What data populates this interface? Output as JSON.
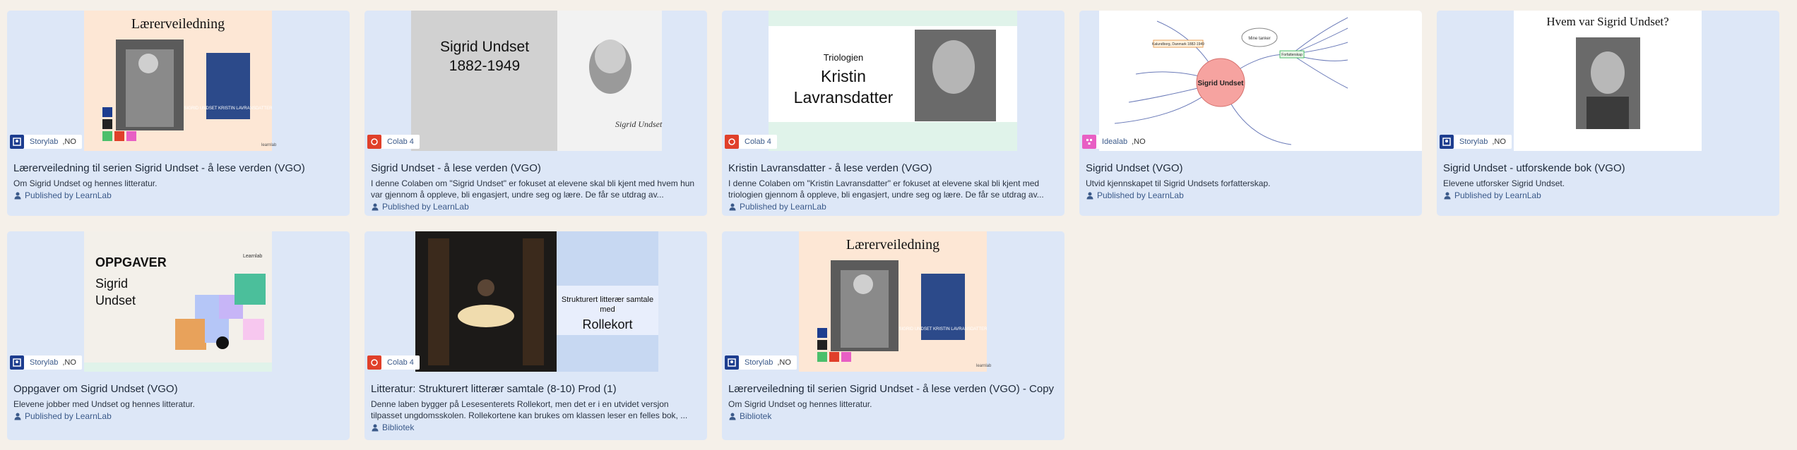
{
  "cards": [
    {
      "title": "Lærerveiledning til serien Sigrid Undset - å lese verden (VGO)",
      "desc": "Om Sigrid Undset og hennes litteratur.",
      "publisher": "Published by LearnLab",
      "lab": "Storylab",
      "lang": ",NO",
      "thumb_heading": "Lærerveiledning",
      "thumb_book": "SIGRID UNDSET KRISTIN LAVRANSDATTER",
      "thumb_logo": "learnlab"
    },
    {
      "title": "Sigrid Undset - å lese verden (VGO)",
      "desc": "I denne Colaben om \"Sigrid Undset\" er fokuset at elevene skal bli kjent med hvem hun var gjennom å oppleve, bli engasjert, undre seg og lære. De får se utdrag av...",
      "publisher": "Published by LearnLab",
      "lab": "Colab 4",
      "lang": "",
      "thumb_name": "Sigrid Undset",
      "thumb_years": "1882-1949",
      "thumb_signature": "Sigrid Undset"
    },
    {
      "title": "Kristin Lavransdatter - å lese verden (VGO)",
      "desc": "I denne Colaben om \"Kristin Lavransdatter\" er fokuset at elevene skal bli kjent med triologien gjennom å oppleve, bli engasjert, undre seg og lære. De får se utdrag av...",
      "publisher": "Published by LearnLab",
      "lab": "Colab 4",
      "lang": "",
      "thumb_small": "Triologien",
      "thumb_big1": "Kristin",
      "thumb_big2": "Lavransdatter"
    },
    {
      "title": "Sigrid Undset (VGO)",
      "desc": "Utvid kjennskapet til Sigrid Undsets forfatterskap.",
      "publisher": "Published by LearnLab",
      "lab": "Idealab",
      "lang": ",NO",
      "thumb_center": "Sigrid Undset",
      "thumb_note": "Mine tanker",
      "thumb_node1": "Forfatterskap",
      "thumb_node2": "Kalundborg, Danmark 1882-1949"
    },
    {
      "title": "Sigrid Undset - utforskende bok (VGO)",
      "desc": "Elevene utforsker Sigrid Undset.",
      "publisher": "Published by LearnLab",
      "lab": "Storylab",
      "lang": ",NO",
      "thumb_heading": "Hvem var Sigrid Undset?"
    },
    {
      "title": "Oppgaver om Sigrid Undset (VGO)",
      "desc": "Elevene jobber med Undset og hennes litteratur.",
      "publisher": "Published by LearnLab",
      "lab": "Storylab",
      "lang": ",NO",
      "thumb_heading": "OPPGAVER",
      "thumb_sub1": "Sigrid",
      "thumb_sub2": "Undset",
      "thumb_logo": "Learnlab"
    },
    {
      "title": "Litteratur: Strukturert litterær samtale (8-10) Prod (1)",
      "desc": "Denne laben bygger på Lesesenterets Rollekort, men det er i en utvidet versjon tilpasset ungdomsskolen. Rollekortene kan brukes om klassen leser en felles bok, ...",
      "publisher": "Bibliotek",
      "lab": "Colab 4",
      "lang": "",
      "thumb_small1": "Strukturert litterær samtale",
      "thumb_small2": "med",
      "thumb_big": "Rollekort"
    },
    {
      "title": "Lærerveiledning til serien Sigrid Undset - å lese verden (VGO) - Copy",
      "desc": "Om Sigrid Undset og hennes litteratur.",
      "publisher": "Bibliotek",
      "lab": "Storylab",
      "lang": ",NO",
      "thumb_heading": "Lærerveiledning",
      "thumb_book": "SIGRID UNDSET KRISTIN LAVRANSDATTER",
      "thumb_logo": "learnlab"
    }
  ],
  "colors": {
    "page_bg": "#f5f0e9",
    "card_bg": "#dde7f7",
    "storylab": "#1d3d8f",
    "colab": "#e0402a",
    "idealab": "#e85fc4",
    "link": "#3b5a8a"
  }
}
